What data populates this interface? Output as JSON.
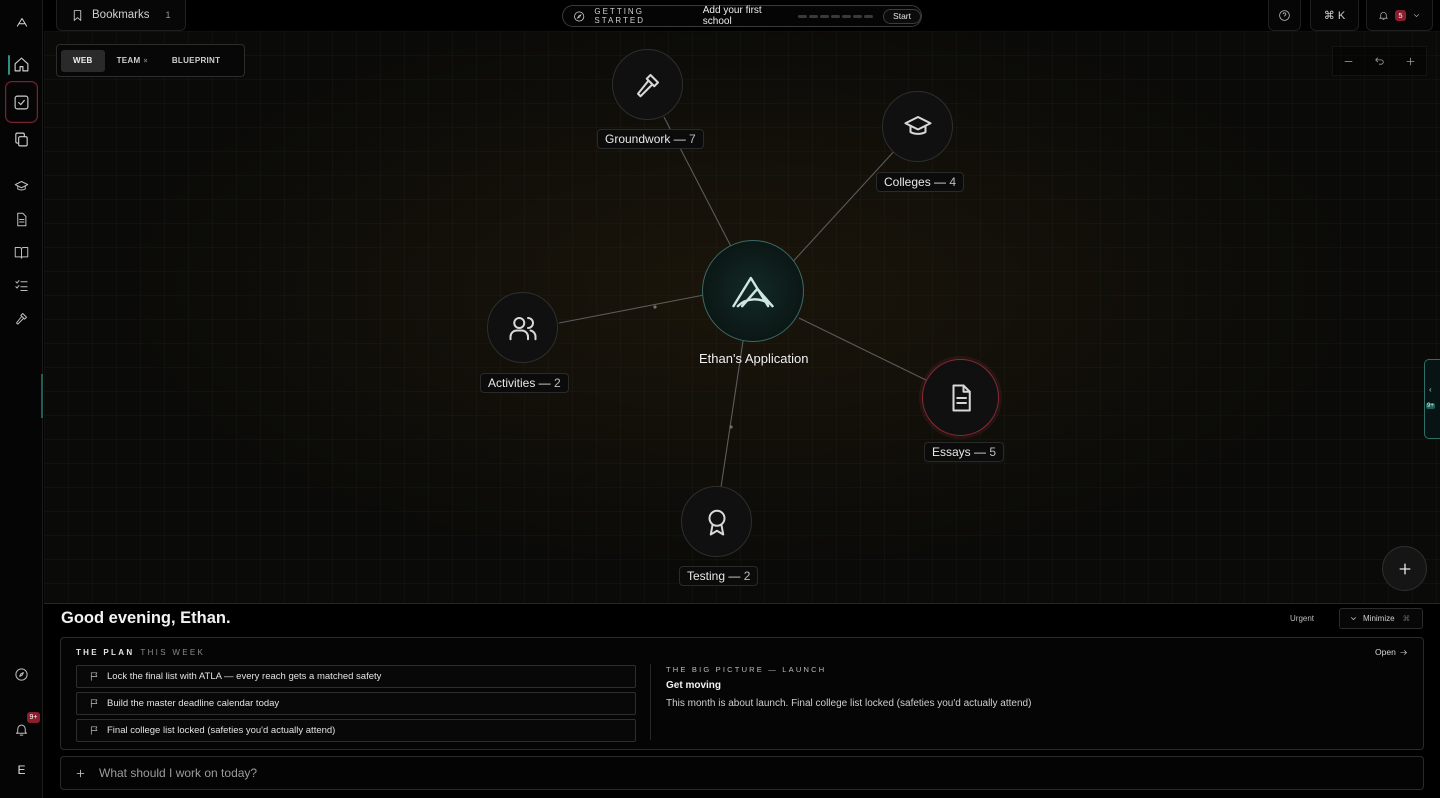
{
  "topbar": {
    "bookmarks_label": "Bookmarks",
    "bookmarks_count": "1",
    "getting_started_kicker": "GETTING STARTED",
    "getting_started_title": "Add your first school",
    "start_label": "Start",
    "cmdk_label": "⌘  K",
    "notifications_count": "5"
  },
  "rail": {
    "badge": "9+",
    "avatar_initial": "E"
  },
  "canvas": {
    "tabs": [
      {
        "label": "WEB",
        "active": true
      },
      {
        "label": "TEAM",
        "active": false
      },
      {
        "label": "BLUEPRINT",
        "active": false
      }
    ],
    "hub_label": "Ethan's Application",
    "nodes": [
      {
        "name": "Groundwork",
        "count": "7",
        "icon": "hammer-icon"
      },
      {
        "name": "Colleges",
        "count": "4",
        "icon": "graduation-cap-icon"
      },
      {
        "name": "Activities",
        "count": "2",
        "icon": "users-icon"
      },
      {
        "name": "Essays",
        "count": "5",
        "icon": "document-icon"
      },
      {
        "name": "Testing",
        "count": "2",
        "icon": "award-icon"
      }
    ],
    "drawer_badge": "9+"
  },
  "dashboard": {
    "greeting": "Good evening, Ethan.",
    "urgent_label": "Urgent",
    "minimize_label": "Minimize",
    "minimize_shortcut": "⌘",
    "plan_kicker": "THE PLAN",
    "plan_period": "THIS WEEK",
    "tasks": [
      "Lock the final list with ATLA — every reach gets a matched safety",
      "Build the master deadline calendar today",
      "Final college list locked (safeties you'd actually attend)"
    ],
    "open_label": "Open",
    "big_picture_kicker": "THE BIG PICTURE — LAUNCH",
    "big_picture_title": "Get moving",
    "big_picture_body": "This month is about launch. Final college list locked (safeties you'd actually attend)",
    "ask_placeholder": "What should I work on today?"
  },
  "colors": {
    "accent_teal": "#2f8f83",
    "alert_red": "#8b1e2d"
  }
}
